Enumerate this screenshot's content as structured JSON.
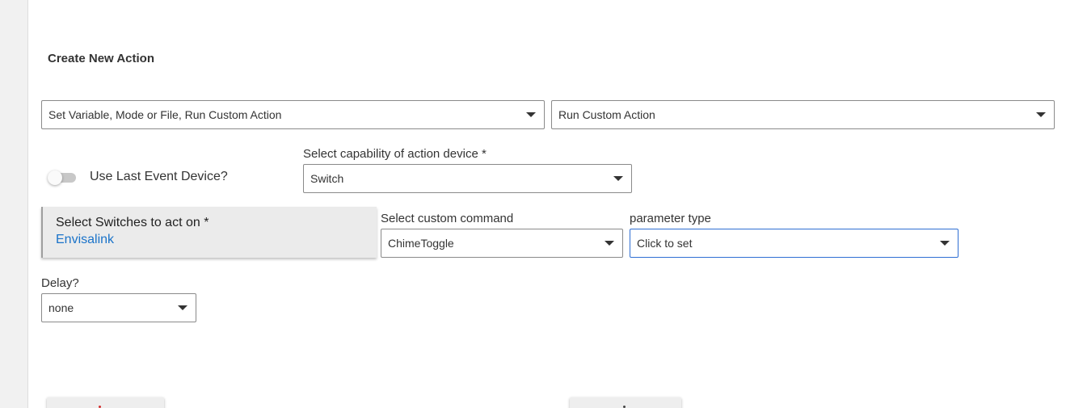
{
  "section": {
    "title": "Create New Action"
  },
  "action_category": {
    "value": "Set Variable, Mode or File, Run Custom Action"
  },
  "action_type": {
    "value": "Run Custom Action"
  },
  "use_last_event_device": {
    "label": "Use Last Event Device?",
    "checked": false
  },
  "capability": {
    "label": "Select capability of action device *",
    "value": "Switch"
  },
  "switches": {
    "label": "Select Switches to act on *",
    "value": "Envisalink"
  },
  "custom_command": {
    "label": "Select custom command",
    "value": "ChimeToggle"
  },
  "parameter_type": {
    "label": "parameter type",
    "value": "Click to set"
  },
  "delay": {
    "label": "Delay?",
    "value": "none"
  },
  "colors": {
    "accent_blue": "#1a73c9",
    "focus_border": "#2f6fd3",
    "card_background": "#ebebeb"
  }
}
